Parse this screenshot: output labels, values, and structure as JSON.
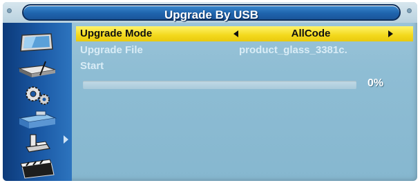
{
  "title": "Upgrade By USB",
  "sidebar": {
    "items": [
      {
        "icon": "tv-screen-icon"
      },
      {
        "icon": "receiver-box-icon"
      },
      {
        "icon": "gears-icon"
      },
      {
        "icon": "tools-icon",
        "selected": true
      },
      {
        "icon": "usb-icon"
      },
      {
        "icon": "media-clapper-icon"
      }
    ]
  },
  "menu": {
    "upgrade_mode": {
      "label": "Upgrade Mode",
      "value": "AllCode"
    },
    "upgrade_file": {
      "label": "Upgrade File",
      "value": "product_glass_3381c."
    },
    "start": {
      "label": "Start"
    }
  },
  "progress": {
    "percent": 0,
    "text": "0%"
  },
  "colors": {
    "accent": "#1f64ad",
    "highlight": "#f3d91c",
    "background": "#8ebdd4"
  }
}
